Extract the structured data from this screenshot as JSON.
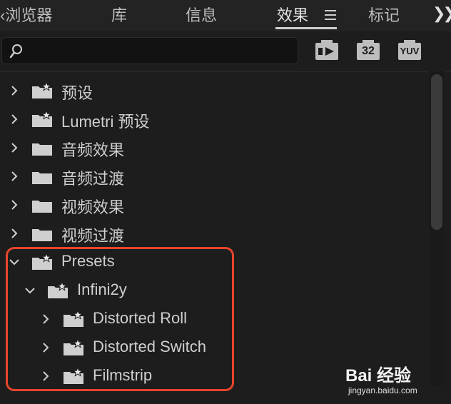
{
  "tabs": [
    {
      "label": "‹浏览器",
      "active": false
    },
    {
      "label": "库",
      "active": false
    },
    {
      "label": "信息",
      "active": false
    },
    {
      "label": "效果",
      "active": true
    },
    {
      "label": "标记",
      "active": false
    }
  ],
  "overflow_icon": "chevron-double-right",
  "search": {
    "value": "",
    "placeholder": ""
  },
  "toolbar": {
    "accelerated_icon": "accelerated-effects",
    "bit32_label": "32",
    "yuv_label": "YUV"
  },
  "tree": [
    {
      "label": "预设",
      "expanded": false,
      "starred": true,
      "depth": 0
    },
    {
      "label": "Lumetri 预设",
      "expanded": false,
      "starred": true,
      "depth": 0
    },
    {
      "label": "音频效果",
      "expanded": false,
      "starred": false,
      "depth": 0
    },
    {
      "label": "音频过渡",
      "expanded": false,
      "starred": false,
      "depth": 0
    },
    {
      "label": "视频效果",
      "expanded": false,
      "starred": false,
      "depth": 0
    },
    {
      "label": "视频过渡",
      "expanded": false,
      "starred": false,
      "depth": 0
    },
    {
      "label": "Presets",
      "expanded": true,
      "starred": true,
      "depth": 0
    },
    {
      "label": "Infini2y",
      "expanded": true,
      "starred": true,
      "depth": 1
    },
    {
      "label": "Distorted Roll",
      "expanded": false,
      "starred": true,
      "depth": 2
    },
    {
      "label": "Distorted Switch",
      "expanded": false,
      "starred": true,
      "depth": 2
    },
    {
      "label": "Filmstrip",
      "expanded": false,
      "starred": true,
      "depth": 2
    }
  ],
  "colors": {
    "highlight": "#e8452d",
    "background": "#1d1d1d",
    "text": "#cfcfcf"
  },
  "watermark": {
    "brand": "Bai 经验",
    "url": "jingyan.baidu.com"
  }
}
